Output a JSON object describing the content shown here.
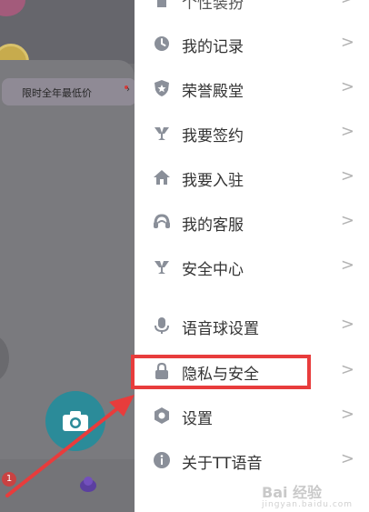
{
  "left_panel": {
    "promo_text": "限时全年最低价",
    "badge_count": "1"
  },
  "menu": {
    "items": [
      {
        "label": "个性装扮",
        "icon": "shirt-icon"
      },
      {
        "label": "我的记录",
        "icon": "clock-icon"
      },
      {
        "label": "荣誉殿堂",
        "icon": "shield-icon"
      },
      {
        "label": "我要签约",
        "icon": "trophy-icon"
      },
      {
        "label": "我要入驻",
        "icon": "home-icon"
      },
      {
        "label": "我的客服",
        "icon": "headset-icon"
      },
      {
        "label": "安全中心",
        "icon": "trophy-icon"
      },
      {
        "label": "语音球设置",
        "icon": "microphone-icon"
      },
      {
        "label": "隐私与安全",
        "icon": "lock-icon"
      },
      {
        "label": "设置",
        "icon": "hexagon-gear-icon"
      },
      {
        "label": "关于TT语音",
        "icon": "info-icon"
      }
    ],
    "chevron": ">"
  },
  "watermark": {
    "main": "Bai 经验",
    "sub": "jingyan.baidu.com"
  },
  "colors": {
    "highlight": "#e83c3c",
    "icon": "#8a8f99",
    "camera": "#2b8b99"
  }
}
